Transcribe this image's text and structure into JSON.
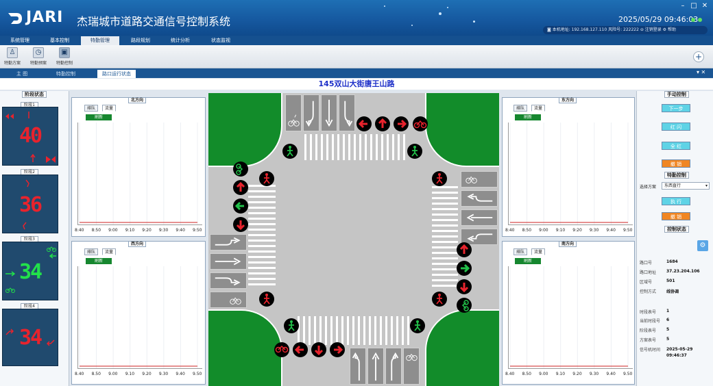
{
  "app": {
    "logo": "JARI",
    "title": "杰瑞城市道路交通信号控制系统",
    "datetime": "2025/05/29 09:46:03",
    "info_text": "◙ 本机地址: 192.168.127.110  风险号: 222222  ⊖ 注销登录 ⚙ 帮助",
    "window_min": "–",
    "window_max": "□",
    "window_close": "✕"
  },
  "menu": [
    "系统管理",
    "基本控制",
    "特勤管理",
    "路段规划",
    "统计分析",
    "状态监视"
  ],
  "toolbar": [
    {
      "label": "特勤方案",
      "icon": "person-icon"
    },
    {
      "label": "特勤预案",
      "icon": "stopwatch-icon"
    },
    {
      "label": "特勤控制",
      "icon": "control-icon"
    }
  ],
  "tabs": [
    "主 图",
    "特勤控制",
    "路口运行状态"
  ],
  "tabbar_controls": "▾ ✕",
  "intersection": {
    "title": "145双山大街唐王山路"
  },
  "phase_panel": {
    "title": "阶段状态",
    "phases": [
      {
        "label": "阶段1",
        "countdown": "40",
        "color": "#e8232d"
      },
      {
        "label": "阶段2",
        "countdown": "36",
        "color": "#e8232d"
      },
      {
        "label": "阶段3",
        "countdown": "34",
        "color": "#22e14a"
      },
      {
        "label": "阶段4",
        "countdown": "34",
        "color": "#e8232d"
      }
    ]
  },
  "chart_panels": [
    {
      "id": "north",
      "title": "北方向"
    },
    {
      "id": "west",
      "title": "西方向"
    },
    {
      "id": "east",
      "title": "东方向"
    },
    {
      "id": "south",
      "title": "南方向"
    }
  ],
  "chart_ui": {
    "tab_queue": "排队",
    "tab_flow": "流量",
    "refresh": "刷新"
  },
  "chart_data": [
    {
      "type": "line",
      "title": "北方向",
      "x": [
        "8:40",
        "8:50",
        "9:00",
        "9:10",
        "9:20",
        "9:30",
        "9:40",
        "9:50"
      ],
      "series": [
        {
          "values": [
            0,
            0,
            0,
            0,
            0,
            0,
            0,
            0
          ]
        }
      ]
    },
    {
      "type": "line",
      "title": "西方向",
      "x": [
        "8.40",
        "8.50",
        "9.00",
        "9.10",
        "9.20",
        "9.30",
        "9.40",
        "9.50"
      ],
      "series": [
        {
          "values": [
            0,
            0,
            0,
            0,
            0,
            0,
            0,
            0
          ]
        }
      ]
    },
    {
      "type": "line",
      "title": "东方向",
      "x": [
        "8:40",
        "8:50",
        "9:00",
        "9:10",
        "9:20",
        "9:30",
        "9:40",
        "9:50"
      ],
      "series": [
        {
          "values": [
            0,
            0,
            0,
            0,
            0,
            0,
            0,
            0
          ]
        }
      ]
    },
    {
      "type": "line",
      "title": "南方向",
      "x": [
        "8.40",
        "8.50",
        "9.00",
        "9.10",
        "9.20",
        "9.30",
        "9.40",
        "9.50"
      ],
      "series": [
        {
          "values": [
            0,
            0,
            0,
            0,
            0,
            0,
            0,
            0
          ]
        }
      ]
    }
  ],
  "right_panel": {
    "manual_title": "手动控制",
    "manual_buttons": [
      {
        "label": "下一步",
        "style": "cyan"
      },
      {
        "label": "红 闪",
        "style": "cyan"
      },
      {
        "label": "全 红",
        "style": "cyan"
      },
      {
        "label": "撤 销",
        "style": "orange"
      }
    ],
    "special_title": "特勤控制",
    "special_label": "选择方案",
    "special_select": "东西直行",
    "special_buttons": [
      {
        "label": "执 行",
        "style": "cyan"
      },
      {
        "label": "撤 销",
        "style": "orange"
      }
    ],
    "status_title": "控制状态",
    "status": [
      {
        "key": "路口号",
        "value": "1684"
      },
      {
        "key": "路口地址",
        "value": "37.23.204.106"
      },
      {
        "key": "区域号",
        "value": "501"
      },
      {
        "key": "控制方式",
        "value": "线协调"
      },
      {
        "key": "时段表号",
        "value": "1"
      },
      {
        "key": "当前时段号",
        "value": "6"
      },
      {
        "key": "阶段表号",
        "value": "5"
      },
      {
        "key": "方案表号",
        "value": "5"
      },
      {
        "key": "信号机时间",
        "value": "2025-05-29 09:46:37"
      }
    ]
  }
}
